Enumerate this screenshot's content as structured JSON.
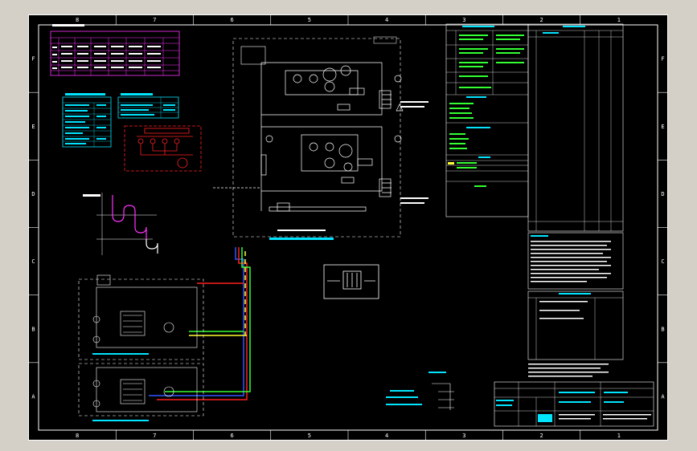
{
  "drawing": {
    "columns": [
      "8",
      "7",
      "6",
      "5",
      "4",
      "3",
      "2",
      "1"
    ],
    "rows": [
      "F",
      "E",
      "D",
      "C",
      "B",
      "A"
    ]
  },
  "colors": {
    "background": "#000000",
    "frame": "#ffffff",
    "cyan": "#00e5ff",
    "magenta": "#ff33ff",
    "red": "#ff2020",
    "yellow": "#ffff33",
    "green": "#33ff33",
    "blue": "#3355ff",
    "grey": "#bfbfbf"
  },
  "labels": {
    "top_left_title": "SCHEDULE",
    "legend_title": "LEGEND",
    "alteration_title": "ALTERATIONS",
    "general_notes_title": "GENERAL NOTES",
    "reference_title": "REFERENCE DRAWINGS",
    "condensing_unit": "CONDENSING UNIT",
    "evap_unit": "EVAPORATOR",
    "title_block": "TITLE BLOCK"
  }
}
